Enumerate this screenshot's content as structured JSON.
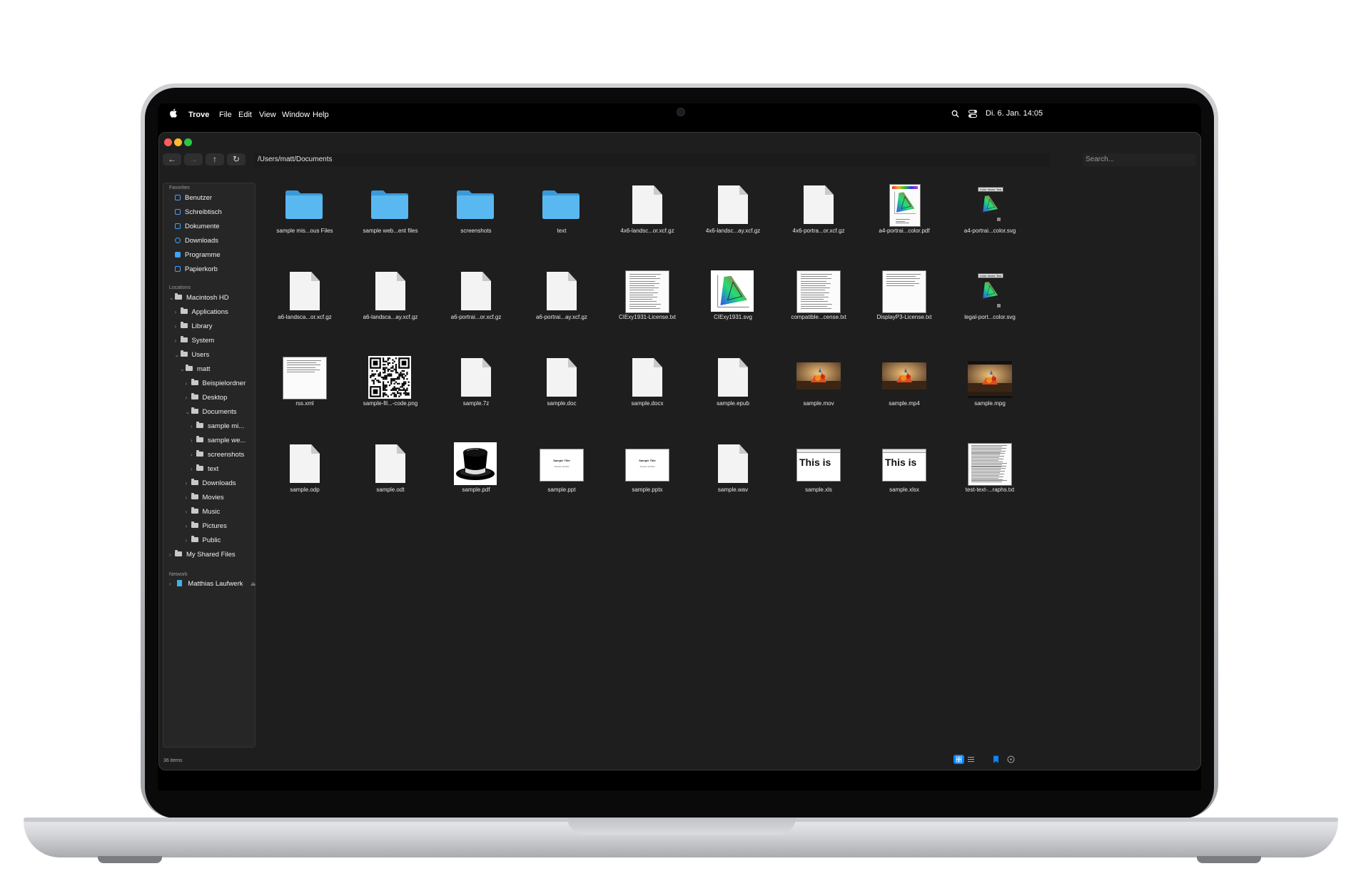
{
  "menubar": {
    "app_name": "Trove",
    "menus": [
      "File",
      "Edit",
      "View",
      "Window",
      "Help"
    ],
    "clock": "Di. 6. Jan.  14:05"
  },
  "toolbar": {
    "path": "/Users/matt/Documents",
    "search_placeholder": "Search..."
  },
  "sidebar": {
    "favorites_heading": "Favorites",
    "favorites": [
      "Benutzer",
      "Schreibtisch",
      "Dokumente",
      "Downloads",
      "Programme",
      "Papierkorb"
    ],
    "locations_heading": "Locations",
    "tree": [
      {
        "label": "Macintosh HD",
        "depth": 0,
        "expanded": true
      },
      {
        "label": "Applications",
        "depth": 1,
        "expanded": false
      },
      {
        "label": "Library",
        "depth": 1,
        "expanded": false
      },
      {
        "label": "System",
        "depth": 1,
        "expanded": false
      },
      {
        "label": "Users",
        "depth": 1,
        "expanded": true
      },
      {
        "label": "matt",
        "depth": 2,
        "expanded": true
      },
      {
        "label": "Beispielordner",
        "depth": 3,
        "expanded": false
      },
      {
        "label": "Desktop",
        "depth": 3,
        "expanded": false
      },
      {
        "label": "Documents",
        "depth": 3,
        "expanded": true
      },
      {
        "label": "sample mi...",
        "depth": 4,
        "expanded": false
      },
      {
        "label": "sample we...",
        "depth": 4,
        "expanded": false
      },
      {
        "label": "screenshots",
        "depth": 4,
        "expanded": false
      },
      {
        "label": "text",
        "depth": 4,
        "expanded": false
      },
      {
        "label": "Downloads",
        "depth": 3,
        "expanded": false
      },
      {
        "label": "Movies",
        "depth": 3,
        "expanded": false
      },
      {
        "label": "Music",
        "depth": 3,
        "expanded": false
      },
      {
        "label": "Pictures",
        "depth": 3,
        "expanded": false
      },
      {
        "label": "Public",
        "depth": 3,
        "expanded": false
      },
      {
        "label": "My Shared Files",
        "depth": 0,
        "expanded": false
      }
    ],
    "network_heading": "Network",
    "network": [
      "Matthias Laufwerk"
    ]
  },
  "files": [
    {
      "name": "sample mis...ous Files",
      "kind": "folder"
    },
    {
      "name": "sample web...ent files",
      "kind": "folder"
    },
    {
      "name": "screenshots",
      "kind": "folder"
    },
    {
      "name": "text",
      "kind": "folder"
    },
    {
      "name": "4x6-landsc...or.xcf.gz",
      "kind": "doc"
    },
    {
      "name": "4x6-landsc...ay.xcf.gz",
      "kind": "doc"
    },
    {
      "name": "4x6-portra...or.xcf.gz",
      "kind": "doc"
    },
    {
      "name": "a4-portrai...color.pdf",
      "kind": "chroma-page"
    },
    {
      "name": "a4-portrai...color.svg",
      "kind": "chroma-small"
    },
    {
      "name": "a6-landsca...or.xcf.gz",
      "kind": "doc"
    },
    {
      "name": "a6-landsca...ay.xcf.gz",
      "kind": "doc"
    },
    {
      "name": "a6-portrai...or.xcf.gz",
      "kind": "doc"
    },
    {
      "name": "a6-portrai...ay.xcf.gz",
      "kind": "doc"
    },
    {
      "name": "CIExy1931-License.txt",
      "kind": "text-page"
    },
    {
      "name": "CIExy1931.svg",
      "kind": "chroma"
    },
    {
      "name": "compatible...cense.txt",
      "kind": "text-page"
    },
    {
      "name": "DisplayP3-License.txt",
      "kind": "text-page-short"
    },
    {
      "name": "legal-port...color.svg",
      "kind": "chroma-small"
    },
    {
      "name": "rss.xml",
      "kind": "text-page-short"
    },
    {
      "name": "sample-fil...-code.png",
      "kind": "qr"
    },
    {
      "name": "sample.7z",
      "kind": "doc"
    },
    {
      "name": "sample.doc",
      "kind": "doc"
    },
    {
      "name": "sample.docx",
      "kind": "doc"
    },
    {
      "name": "sample.epub",
      "kind": "doc"
    },
    {
      "name": "sample.mov",
      "kind": "video"
    },
    {
      "name": "sample.mp4",
      "kind": "video"
    },
    {
      "name": "sample.mpg",
      "kind": "video-framed"
    },
    {
      "name": "sample.odp",
      "kind": "doc"
    },
    {
      "name": "sample.odt",
      "kind": "doc"
    },
    {
      "name": "sample.pdf",
      "kind": "tophat"
    },
    {
      "name": "sample.ppt",
      "kind": "slide"
    },
    {
      "name": "sample.pptx",
      "kind": "slide"
    },
    {
      "name": "sample.wav",
      "kind": "doc"
    },
    {
      "name": "sample.xls",
      "kind": "sheet"
    },
    {
      "name": "sample.xlsx",
      "kind": "sheet"
    },
    {
      "name": "test-text-...raphs.txt",
      "kind": "dense-page"
    }
  ],
  "thumb_text": {
    "slide_title": "Sample Title",
    "slide_subtitle": "Sample Subtitle",
    "sheet_text": "This is",
    "chroma_header": "Color Vector Test"
  },
  "status": {
    "item_count": "36 items"
  },
  "colors": {
    "accent": "#0a84ff",
    "folder": "#5ab8f0",
    "window_bg": "#1e1e1e",
    "sidebar_bg": "#262626"
  }
}
